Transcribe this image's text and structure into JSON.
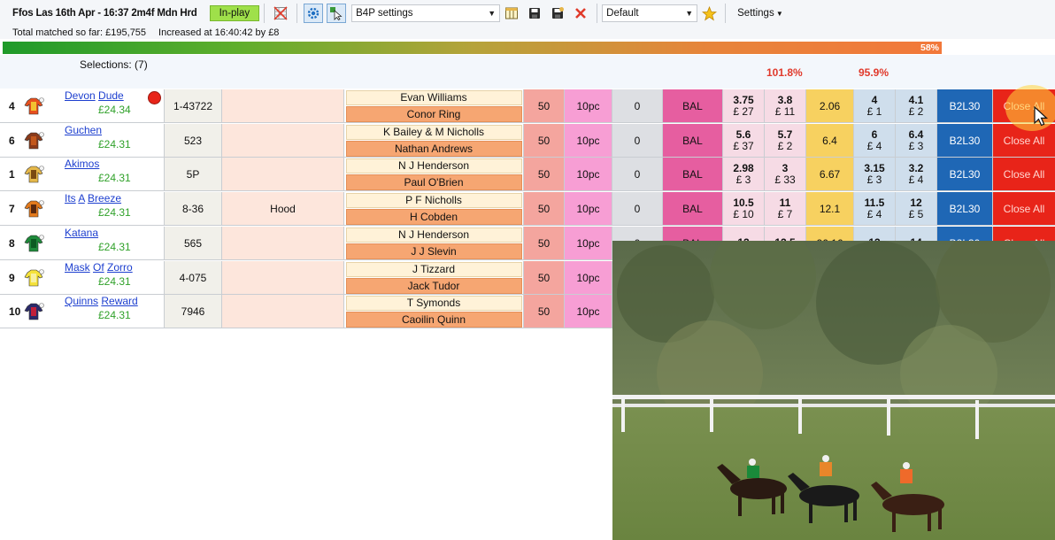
{
  "toolbar": {
    "race_title": "Ffos Las 16th Apr - 16:37 2m4f Mdn Hrd",
    "inplay_label": "In-play",
    "settings_select": "B4P settings",
    "profile_select": "Default",
    "settings_menu": "Settings",
    "icons": [
      "grid-off-icon",
      "gear-icon",
      "cursor-select-icon",
      "columns-icon",
      "save-icon",
      "save-as-icon",
      "delete-icon",
      "favourite-star-icon"
    ]
  },
  "info": {
    "total_matched": "Total matched so far: £195,755",
    "increased": "Increased at 16:40:42 by £8"
  },
  "progress": {
    "value": 0.58,
    "label": "58%"
  },
  "header": {
    "selections": "Selections: (7)",
    "back_book": "101.8%",
    "lay_book": "95.9%"
  },
  "common": {
    "stake": "50",
    "percent": "10pc",
    "zero": "0",
    "bal": "BAL",
    "b2l": "B2L30",
    "close": "Close All"
  },
  "rows": [
    {
      "num": "4",
      "name_words": [
        "Devon",
        "Dude"
      ],
      "money": "£24.34",
      "form": "1-43722",
      "headgear": "",
      "trainer": "Evan Williams",
      "jockey": "Conor Ring",
      "back1": "3.75",
      "back1_amt": "£ 27",
      "back2": "3.8",
      "back2_amt": "£ 11",
      "mid": "2.06",
      "lay1": "4",
      "lay1_amt": "£ 1",
      "lay2": "4.1",
      "lay2_amt": "£ 2",
      "silk_colors": [
        "#e7501e",
        "#f2c230"
      ]
    },
    {
      "num": "6",
      "name_words": [
        "Guchen"
      ],
      "money": "£24.31",
      "form": "523",
      "headgear": "",
      "trainer": "K Bailey & M Nicholls",
      "jockey": "Nathan Andrews",
      "back1": "5.6",
      "back1_amt": "£ 37",
      "back2": "5.7",
      "back2_amt": "£ 2",
      "mid": "6.4",
      "lay1": "6",
      "lay1_amt": "£ 4",
      "lay2": "6.4",
      "lay2_amt": "£ 3",
      "silk_colors": [
        "#8a3a1a",
        "#c2571c"
      ]
    },
    {
      "num": "1",
      "name_words": [
        "Akimos"
      ],
      "money": "£24.31",
      "form": "5P",
      "headgear": "",
      "trainer": "N J Henderson",
      "jockey": "Paul O'Brien",
      "back1": "2.98",
      "back1_amt": "£ 3",
      "back2": "3",
      "back2_amt": "£ 33",
      "mid": "6.67",
      "lay1": "3.15",
      "lay1_amt": "£ 3",
      "lay2": "3.2",
      "lay2_amt": "£ 4",
      "silk_colors": [
        "#e5b84a",
        "#7a4a12"
      ]
    },
    {
      "num": "7",
      "name_words": [
        "Its",
        "A",
        "Breeze"
      ],
      "money": "£24.31",
      "form": "8-36",
      "headgear": "Hood",
      "trainer": "P F Nicholls",
      "jockey": "H Cobden",
      "back1": "10.5",
      "back1_amt": "£ 10",
      "back2": "11",
      "back2_amt": "£ 7",
      "mid": "12.1",
      "lay1": "11.5",
      "lay1_amt": "£ 4",
      "lay2": "12",
      "lay2_amt": "£ 5",
      "silk_colors": [
        "#e37a1c",
        "#5a2a10"
      ]
    },
    {
      "num": "8",
      "name_words": [
        "Katana"
      ],
      "money": "£24.31",
      "form": "565",
      "headgear": "",
      "trainer": "N J Henderson",
      "jockey": "J J Slevin",
      "back1": "12",
      "back1_amt": "",
      "back2": "12.5",
      "back2_amt": "",
      "mid": "26.16",
      "lay1": "13",
      "lay1_amt": "",
      "lay2": "14",
      "lay2_amt": "",
      "silk_colors": [
        "#1e8a3a",
        "#0c5a22"
      ]
    },
    {
      "num": "9",
      "name_words": [
        "Mask",
        "Of",
        "Zorro"
      ],
      "money": "£24.31",
      "form": "4-075",
      "headgear": "",
      "trainer": "J Tizzard",
      "jockey": "Jack Tudor",
      "back1": "",
      "back1_amt": "",
      "back2": "",
      "back2_amt": "",
      "mid": "",
      "lay1": "",
      "lay1_amt": "",
      "lay2": "",
      "lay2_amt": "",
      "silk_colors": [
        "#f5e23a",
        "#f7f0a0"
      ]
    },
    {
      "num": "10",
      "name_words": [
        "Quinns",
        "Reward"
      ],
      "money": "£24.31",
      "form": "7946",
      "headgear": "",
      "trainer": "T Symonds",
      "jockey": "Caoilin Quinn",
      "back1": "",
      "back1_amt": "",
      "back2": "",
      "back2_amt": "",
      "mid": "",
      "lay1": "",
      "lay1_amt": "",
      "lay2": "",
      "lay2_amt": "",
      "silk_colors": [
        "#2a2a6a",
        "#c2203a"
      ]
    }
  ]
}
